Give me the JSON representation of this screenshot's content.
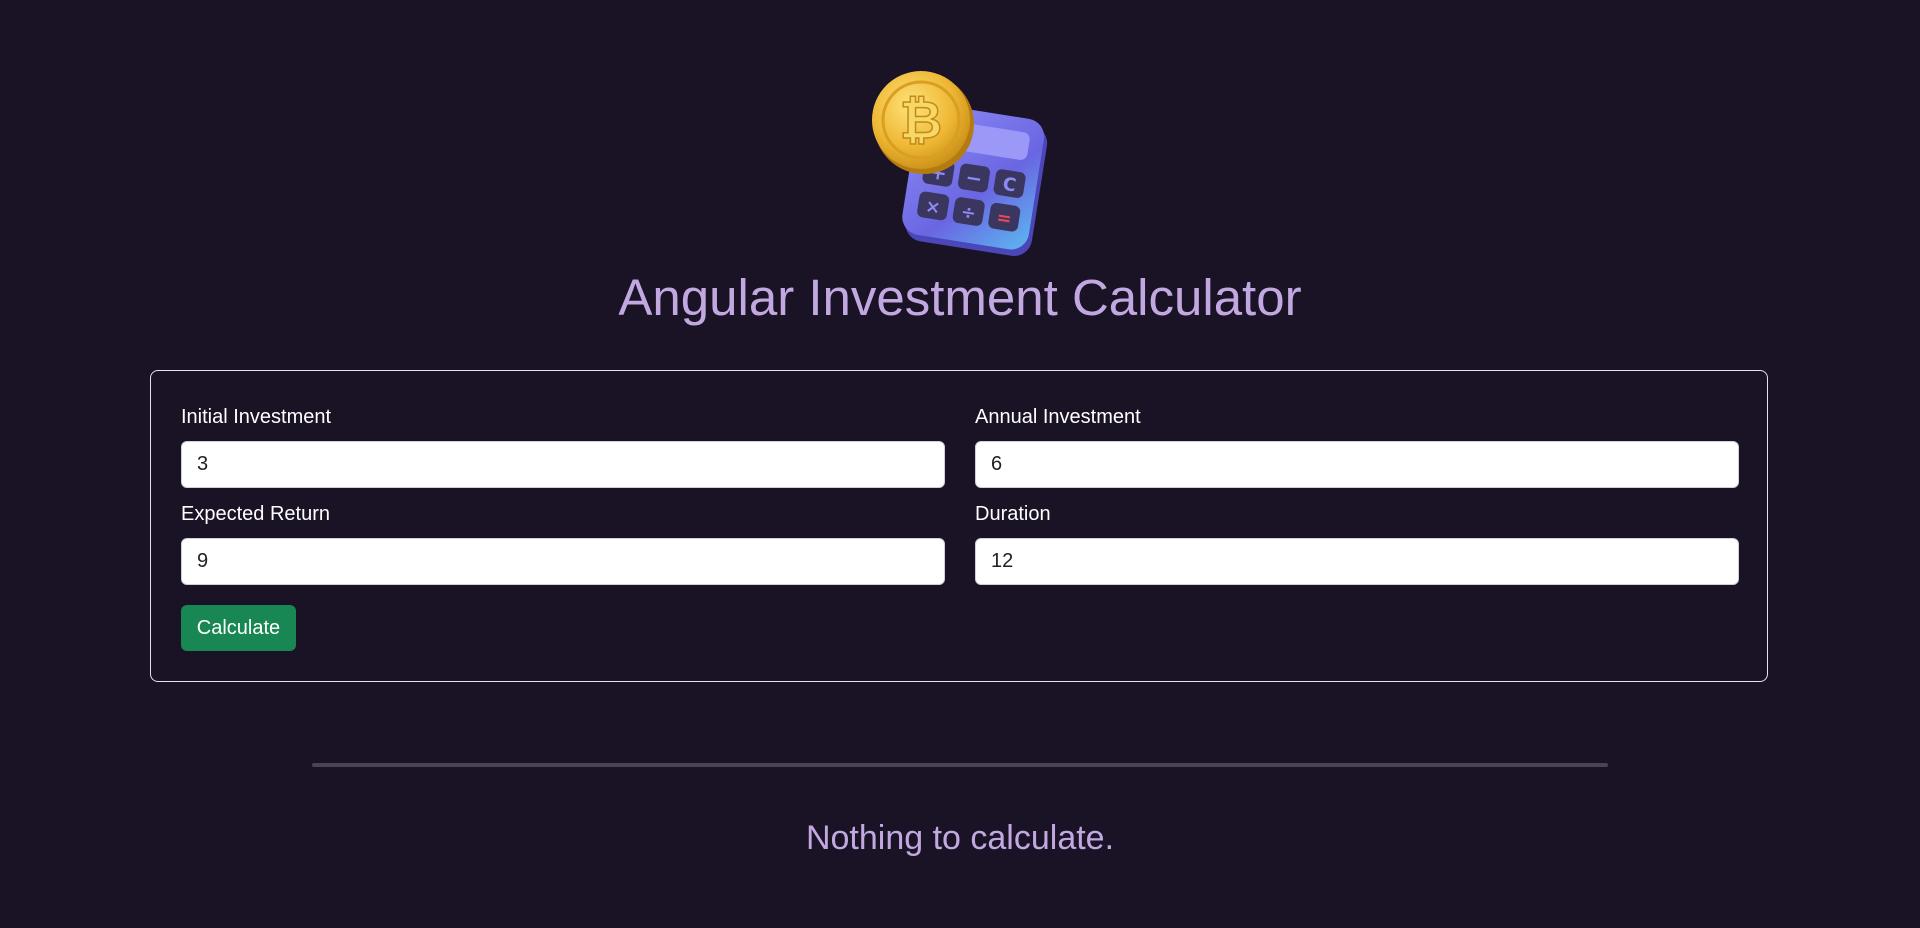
{
  "header": {
    "logo_icon": "bitcoin-calculator-icon",
    "title": "Angular Investment Calculator"
  },
  "form": {
    "initial_investment": {
      "label": "Initial Investment",
      "value": "3"
    },
    "annual_investment": {
      "label": "Annual Investment",
      "value": "6"
    },
    "expected_return": {
      "label": "Expected Return",
      "value": "9"
    },
    "duration": {
      "label": "Duration",
      "value": "12"
    },
    "submit_label": "Calculate"
  },
  "results": {
    "empty_message": "Nothing to calculate."
  },
  "colors": {
    "background": "#1a1225",
    "title": "#c2a8e0",
    "button": "#198754",
    "card_border": "#e8e0f0"
  }
}
